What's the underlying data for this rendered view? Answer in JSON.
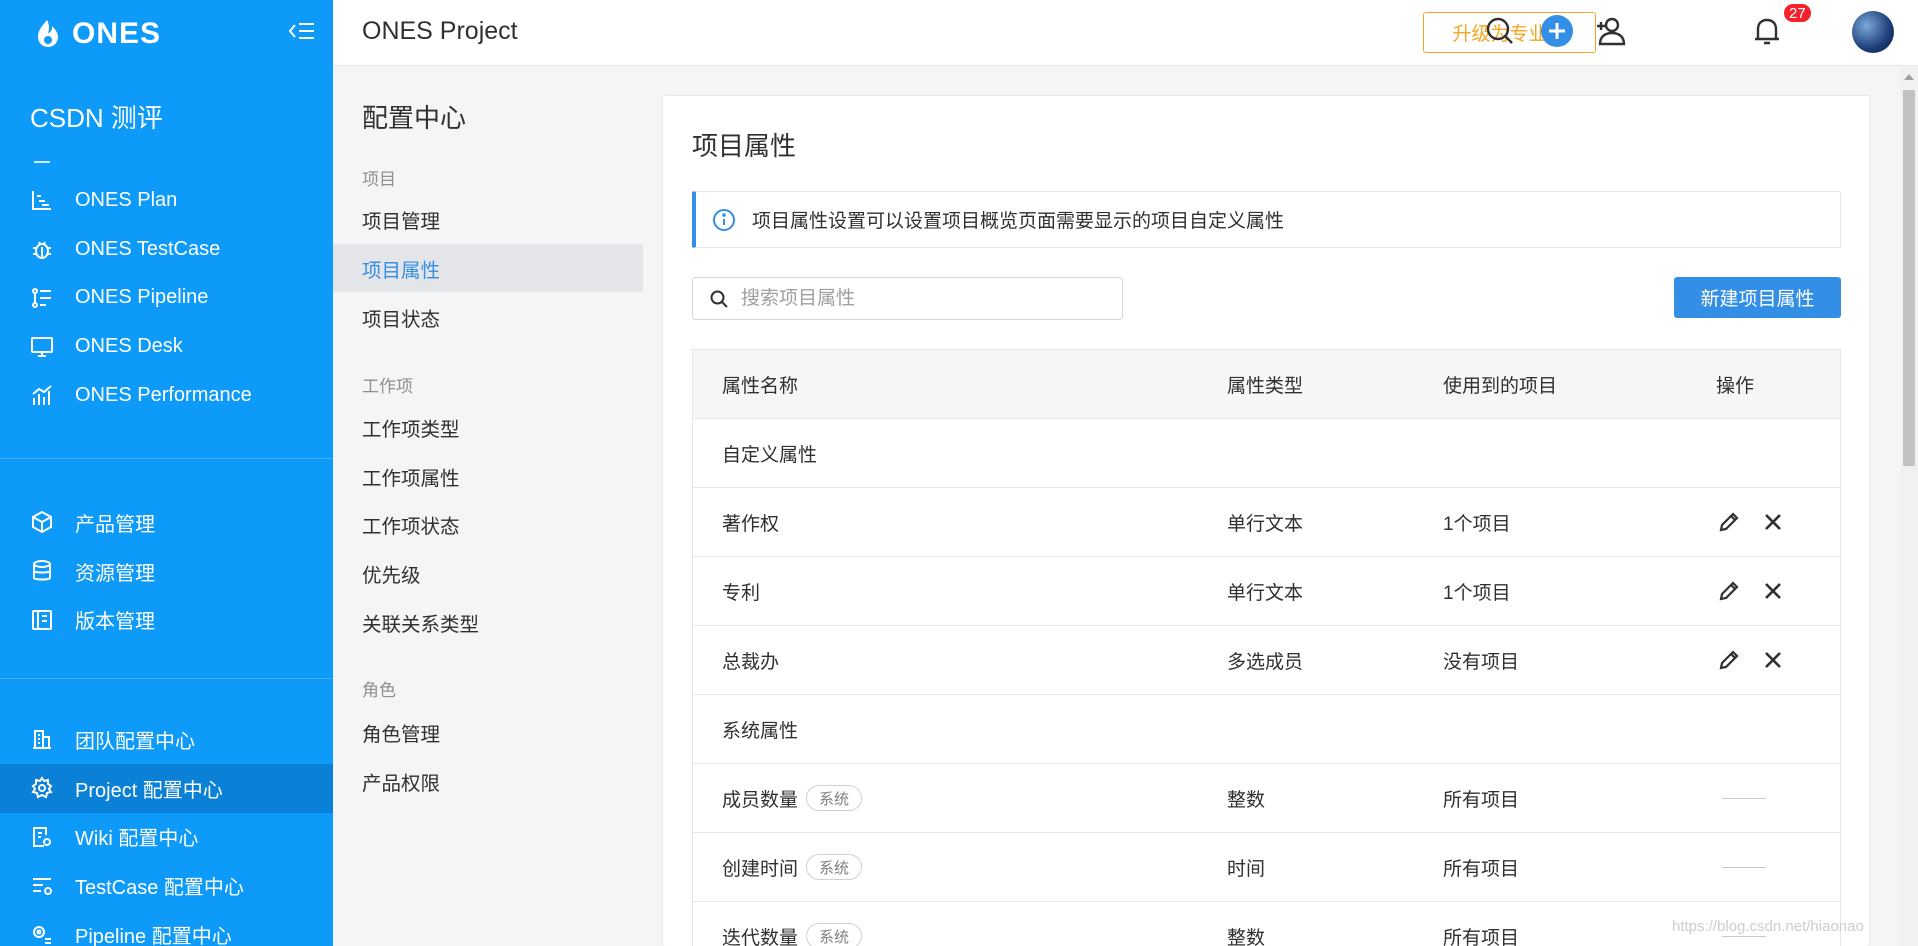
{
  "sidebar": {
    "logo": "ONES",
    "workspace": "CSDN 测评",
    "products": [
      {
        "label": "ONES Plan",
        "icon": "plan-icon"
      },
      {
        "label": "ONES TestCase",
        "icon": "bug-icon"
      },
      {
        "label": "ONES Pipeline",
        "icon": "pipeline-icon"
      },
      {
        "label": "ONES Desk",
        "icon": "monitor-icon"
      },
      {
        "label": "ONES Performance",
        "icon": "performance-chart-icon"
      }
    ],
    "management": [
      {
        "label": "产品管理",
        "icon": "cube-icon"
      },
      {
        "label": "资源管理",
        "icon": "database-icon"
      },
      {
        "label": "版本管理",
        "icon": "version-icon"
      }
    ],
    "config": [
      {
        "label": "团队配置中心",
        "icon": "building-icon"
      },
      {
        "label": "Project 配置中心",
        "icon": "gear-icon",
        "active": true
      },
      {
        "label": "Wiki 配置中心",
        "icon": "wiki-settings-icon"
      },
      {
        "label": "TestCase 配置中心",
        "icon": "list-settings-icon"
      },
      {
        "label": "Pipeline 配置中心",
        "icon": "pipeline-settings-icon"
      }
    ]
  },
  "header": {
    "title": "ONES Project",
    "upgrade_label": "升级为专业版",
    "notification_count": "27",
    "icons": [
      "search-icon",
      "add-icon",
      "add-user-icon",
      "bell-icon"
    ]
  },
  "config_menu": {
    "title": "配置中心",
    "groups": [
      {
        "label": "项目",
        "items": [
          "项目管理",
          "项目属性",
          "项目状态"
        ]
      },
      {
        "label": "工作项",
        "items": [
          "工作项类型",
          "工作项属性",
          "工作项状态",
          "优先级",
          "关联关系类型"
        ]
      },
      {
        "label": "角色",
        "items": [
          "角色管理",
          "产品权限"
        ]
      }
    ],
    "active_item": "项目属性"
  },
  "main": {
    "title": "项目属性",
    "info_text": "项目属性设置可以设置项目概览页面需要显示的项目自定义属性",
    "search_placeholder": "搜索项目属性",
    "new_button": "新建项目属性",
    "columns": [
      "属性名称",
      "属性类型",
      "使用到的项目",
      "操作"
    ],
    "custom_group_label": "自定义属性",
    "custom_rows": [
      {
        "name": "著作权",
        "type": "单行文本",
        "used": "1个项目"
      },
      {
        "name": "专利",
        "type": "单行文本",
        "used": "1个项目"
      },
      {
        "name": "总裁办",
        "type": "多选成员",
        "used": "没有项目"
      }
    ],
    "system_group_label": "系统属性",
    "system_tag": "系统",
    "system_rows": [
      {
        "name": "成员数量",
        "type": "整数",
        "used": "所有项目"
      },
      {
        "name": "创建时间",
        "type": "时间",
        "used": "所有项目"
      },
      {
        "name": "迭代数量",
        "type": "整数",
        "used": "所有项目"
      }
    ]
  },
  "watermark": "https://blog.csdn.net/hiaonao"
}
